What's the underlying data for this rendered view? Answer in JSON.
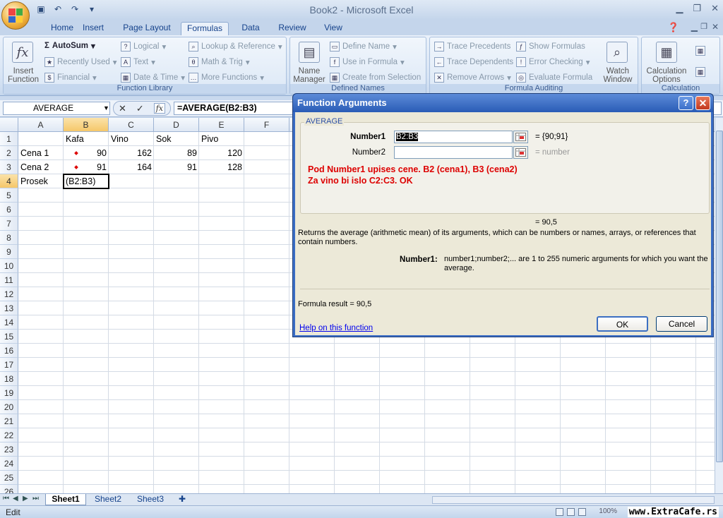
{
  "app": {
    "title": "Book2 - Microsoft Excel"
  },
  "tabs": [
    "Home",
    "Insert",
    "Page Layout",
    "Formulas",
    "Data",
    "Review",
    "View"
  ],
  "active_tab": "Formulas",
  "ribbon": {
    "function_library": {
      "title": "Function Library",
      "insert_function": "Insert Function",
      "autosum": "AutoSum",
      "recently_used": "Recently Used",
      "financial": "Financial",
      "logical": "Logical",
      "text": "Text",
      "date_time": "Date & Time",
      "lookup": "Lookup & Reference",
      "math": "Math & Trig",
      "more": "More Functions"
    },
    "defined_names": {
      "title": "Defined Names",
      "name_manager": "Name Manager",
      "define_name": "Define Name",
      "use_in_formula": "Use in Formula",
      "create_from_selection": "Create from Selection"
    },
    "formula_auditing": {
      "title": "Formula Auditing",
      "trace_precedents": "Trace Precedents",
      "trace_dependents": "Trace Dependents",
      "remove_arrows": "Remove Arrows",
      "show_formulas": "Show Formulas",
      "error_checking": "Error Checking",
      "evaluate_formula": "Evaluate Formula",
      "watch_window": "Watch Window"
    },
    "calculation": {
      "title": "Calculation",
      "options": "Calculation Options"
    }
  },
  "formula_bar": {
    "name_box": "AVERAGE",
    "formula": "=AVERAGE(B2:B3)"
  },
  "grid": {
    "columns": [
      "A",
      "B",
      "C",
      "D",
      "E",
      "F"
    ],
    "rows": [
      "1",
      "2",
      "3",
      "4",
      "5",
      "6",
      "7",
      "8",
      "9",
      "10",
      "11",
      "12",
      "13",
      "14",
      "15",
      "16",
      "17",
      "18",
      "19",
      "20",
      "21",
      "22",
      "23",
      "24",
      "25",
      "26"
    ],
    "cells": {
      "B1": "Kafa",
      "C1": "Vino",
      "D1": "Sok",
      "E1": "Pivo",
      "A2": "Cena 1",
      "B2": "90",
      "C2": "162",
      "D2": "89",
      "E2": "120",
      "A3": "Cena 2",
      "B3": "91",
      "C3": "164",
      "D3": "91",
      "E3": "128",
      "A4": "Prosek",
      "B4": "(B2:B3)"
    }
  },
  "sheets": [
    "Sheet1",
    "Sheet2",
    "Sheet3"
  ],
  "active_sheet": "Sheet1",
  "status": {
    "mode": "Edit",
    "zoom": "100%",
    "watermark": "www.ExtraCafe.rs"
  },
  "dialog": {
    "title": "Function Arguments",
    "function_name": "AVERAGE",
    "number1_label": "Number1",
    "number1_value": "B2:B3",
    "number1_result": "=   {90;91}",
    "number2_label": "Number2",
    "number2_value": "",
    "number2_result": "=   number",
    "note_line1": "Pod Number1 upises cene. B2 (cena1), B3 (cena2)",
    "note_line2": "Za vino bi islo C2:C3. OK",
    "preview_result": "=   90,5",
    "description": "Returns the average (arithmetic mean) of its arguments, which can be numbers or names, arrays, or references that contain numbers.",
    "arg_help_label": "Number1:",
    "arg_help_text": "number1;number2;... are 1 to 255 numeric arguments for which you want the average.",
    "formula_result": "Formula result =    90,5",
    "help_link": "Help on this function",
    "ok": "OK",
    "cancel": "Cancel"
  },
  "colors": {
    "accent": "#2a5cb6",
    "note_red": "#dd0000",
    "title_blue": "#15428b"
  }
}
